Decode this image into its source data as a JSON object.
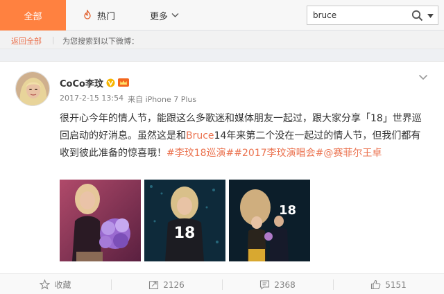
{
  "topbar": {
    "tabs": [
      {
        "label": "全部",
        "active": true
      },
      {
        "label": "热门",
        "icon": "fire-icon"
      },
      {
        "label": "更多",
        "icon": "chevron-down-icon"
      }
    ],
    "search": {
      "value": "bruce"
    }
  },
  "breadcrumb": {
    "back": "返回全部",
    "separator": "|",
    "text": "为您搜索到以下微博："
  },
  "post": {
    "username": "CoCo李玟",
    "time": "2017-2-15 13:54",
    "source": "来自 iPhone 7 Plus",
    "text_parts": [
      "很开心今年的情人节，能跟这么多歌迷和媒体朋友一起过，跟大家分享「18」世界巡回启动的好消息。虽然这是和",
      "Bruce",
      "14年来第二个没在一起过的情人节，但我们都有收到彼此准备的惊喜哦！",
      "#李玟18巡演#",
      "#2017李玟演唱会#",
      "@赛菲尔王卓"
    ],
    "photos": [
      {
        "overlay_text": ""
      },
      {
        "overlay_text": "18"
      },
      {
        "overlay_text": "18"
      }
    ]
  },
  "actions": {
    "favorite": "收藏",
    "repost": "2126",
    "comment": "2368",
    "like": "5151"
  },
  "colors": {
    "accent": "#ff8140",
    "link": "#eb7350",
    "background": "#eef0f3"
  }
}
